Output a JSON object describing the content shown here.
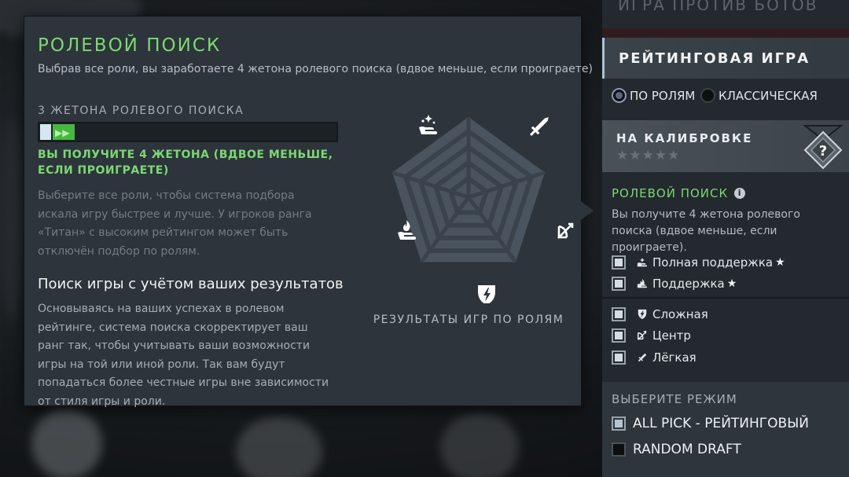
{
  "tooltip": {
    "title": "РОЛЕВОЙ ПОИСК",
    "subtitle": "Выбрав все роли, вы заработаете 4 жетона ролевого поиска (вдвое меньше, если проиграете)",
    "tokens_label": "3 ЖЕТОНА РОЛЕВОГО ПОИСКА",
    "token_progress_chevrons": "▶▶",
    "gain_text": "ВЫ ПОЛУЧИТЕ 4 ЖЕТОНА (ВДВОЕ МЕНЬШЕ, ЕСЛИ ПРОИГРАЕТЕ)",
    "gray_paragraph": "Выберите все роли, чтобы система подбора искала игру быстрее и лучше. У игроков ранга «Титан» с высоким рейтингом может быть отключён подбор по ролям.",
    "section_title": "Поиск игры с учётом ваших результатов",
    "body_paragraph": "Основываясь на ваших успехах в ролевом рейтинге, система поиска скорректирует ваш ранг так, чтобы учитывать ваши возможности игры на той или иной роли. Так вам будут попадаться более честные игры вне зависимости от стиля игры и роли.",
    "radar_caption": "РЕЗУЛЬТАТЫ ИГР ПО РОЛЯМ",
    "radar_icons": [
      "hard-support-icon",
      "carry-sword-icon",
      "mid-bow-icon",
      "offlane-shield-icon",
      "support-flame-icon"
    ]
  },
  "right_panel": {
    "top_faded_text": "ИГРА ПРОТИВ БОТОВ",
    "ranked_title": "РЕЙТИНГОВАЯ ИГРА",
    "radio_roles": "ПО РОЛЯМ",
    "radio_classic": "КЛАССИЧЕСКАЯ",
    "calibration_title": "НА КАЛИБРОВКЕ",
    "calibration_stars": "★★★★★",
    "medal_symbol": "?",
    "role_search_title": "РОЛЕВОЙ ПОИСК",
    "info_symbol": "i",
    "role_search_desc": "Вы получите 4 жетона ролевого поиска (вдвое меньше, если проиграете).",
    "roles": [
      {
        "label": "Полная поддержка",
        "star": "★"
      },
      {
        "label": "Поддержка",
        "star": "★"
      },
      {
        "label": "Сложная",
        "star": ""
      },
      {
        "label": "Центр",
        "star": ""
      },
      {
        "label": "Лёгкая",
        "star": ""
      }
    ],
    "mode_title": "ВЫБЕРИТЕ РЕЖИМ",
    "modes": [
      {
        "label": "ALL PICK - РЕЙТИНГОВЫЙ",
        "checked": true
      },
      {
        "label": "RANDOM DRAFT",
        "checked": false
      }
    ]
  },
  "colors": {
    "accent_green": "#7cd873",
    "panel_bg": "#2d343b",
    "right_panel_bg": "#23292e"
  }
}
